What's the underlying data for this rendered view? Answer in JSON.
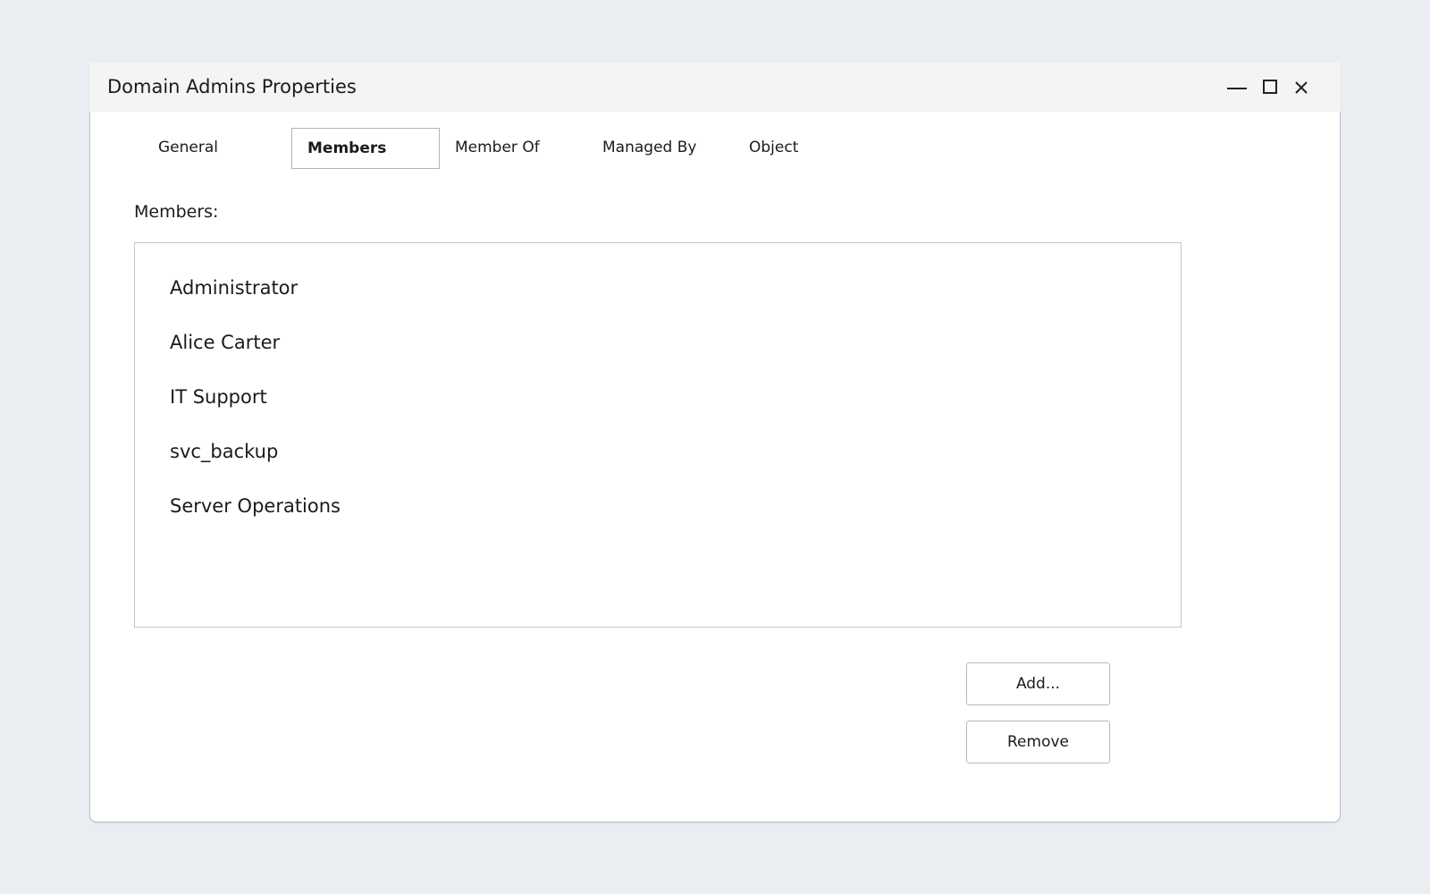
{
  "window": {
    "title": "Domain Admins Properties",
    "controls": {
      "minimize": "minimize-icon",
      "maximize": "maximize-icon",
      "close": "close-icon"
    }
  },
  "tabs": [
    {
      "label": "General",
      "active": false
    },
    {
      "label": "Members",
      "active": true
    },
    {
      "label": "Member Of",
      "active": false
    },
    {
      "label": "Managed By",
      "active": false
    },
    {
      "label": "Object",
      "active": false
    }
  ],
  "members": {
    "label": "Members:",
    "items": [
      "Administrator",
      "Alice Carter",
      "IT Support",
      "svc_backup",
      "Server Operations"
    ]
  },
  "buttons": {
    "add": "Add...",
    "remove": "Remove"
  },
  "colors": {
    "background": "#eaeef3",
    "titlebar": "#f4f4f4",
    "window": "#ffffff",
    "border": "#b6bcc5"
  }
}
